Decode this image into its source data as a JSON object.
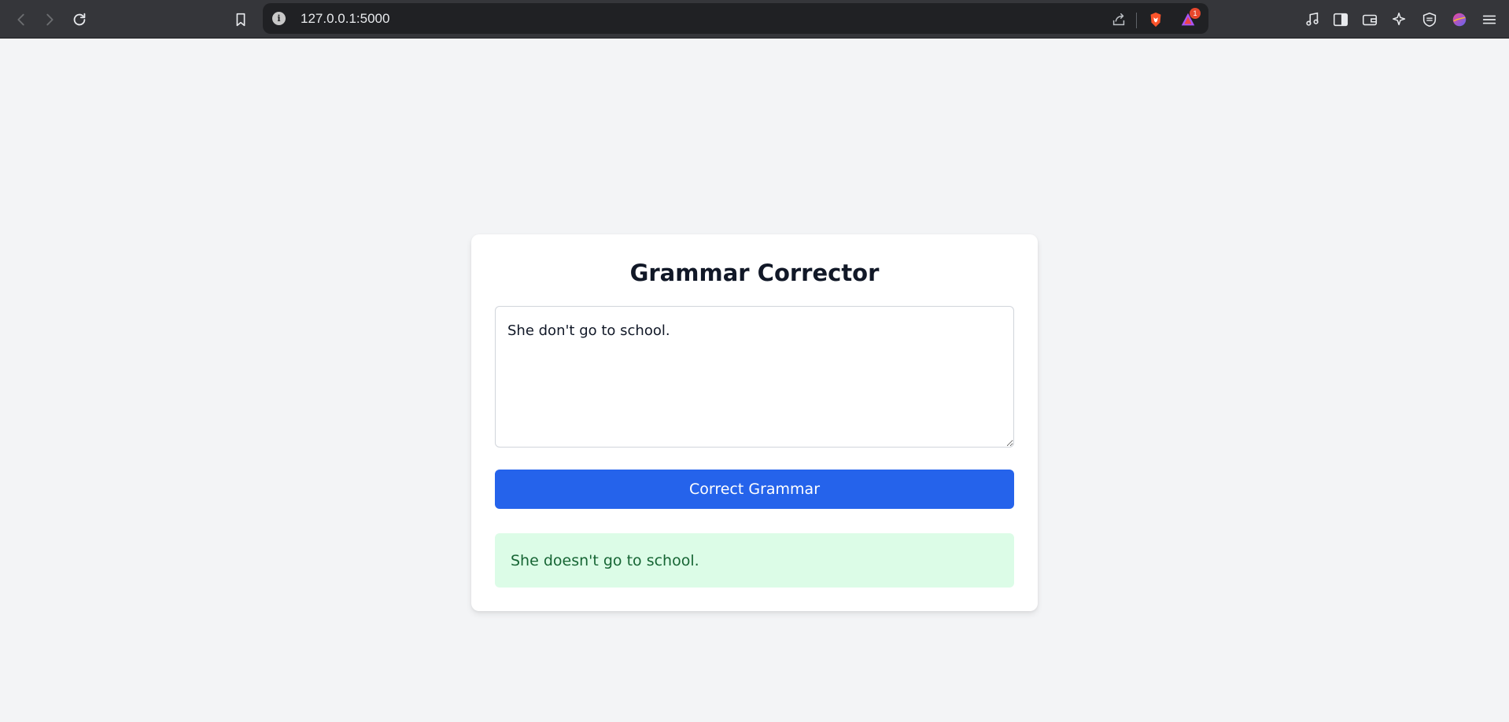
{
  "browser": {
    "url": "127.0.0.1:5000",
    "notification_count": "1",
    "icons": [
      "back-icon",
      "forward-icon",
      "reload-icon",
      "bookmark-icon",
      "site-info-icon",
      "share-icon",
      "brave-shields-icon",
      "brave-rewards-icon",
      "media-icon",
      "sidebar-icon",
      "wallet-icon",
      "leo-ai-icon",
      "vpn-icon",
      "profile-icon",
      "menu-icon"
    ],
    "colors": {
      "toolbar": "#35363a",
      "urlbar": "#202124"
    }
  },
  "app": {
    "title": "Grammar Corrector",
    "input_value": "She don't go to school.",
    "button_label": "Correct Grammar",
    "result_text": "She doesn't go to school.",
    "colors": {
      "page_bg": "#f3f4f6",
      "button": "#2563eb",
      "result_bg": "#dcfce7",
      "result_text": "#166534"
    }
  }
}
